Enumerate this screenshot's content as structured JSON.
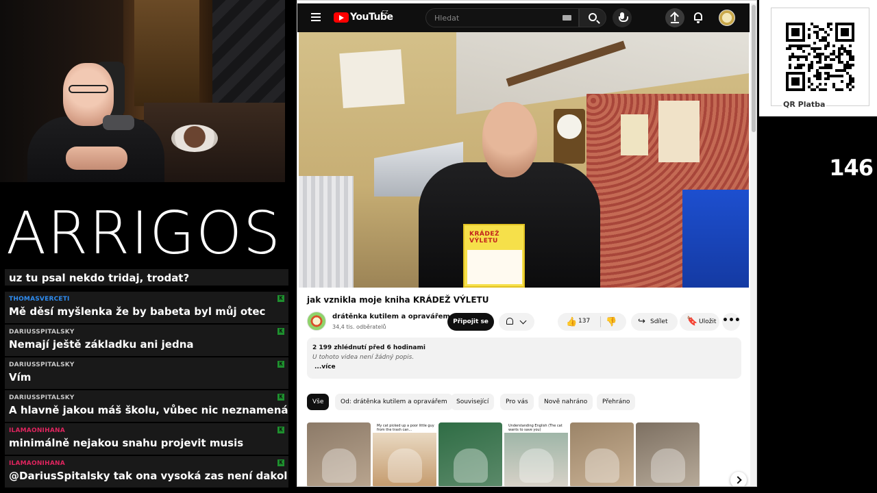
{
  "stream": {
    "logo_text": "ARRIGOS",
    "viewer_count": "146",
    "qr_label": "QR Platba"
  },
  "chat": {
    "messages": [
      {
        "user": "",
        "text": "uz tu psal nekdo tridaj, trodat?",
        "user_color": "#8a8a8a",
        "badge": false
      },
      {
        "user": "THOMASVERCETI",
        "text": "Mě děsí myšlenka že by babeta byl můj otec",
        "user_color": "#2e8cf0",
        "badge": true
      },
      {
        "user": "DARIUSSPITALSKY",
        "text": "Nemají ještě základku ani jedna",
        "user_color": "#c8c8c8",
        "badge": true
      },
      {
        "user": "DARIUSSPITALSKY",
        "text": "Vím",
        "user_color": "#c8c8c8",
        "badge": true
      },
      {
        "user": "DARIUSSPITALSKY",
        "text": "A hlavně jakou máš školu, vůbec nic neznamená",
        "user_color": "#c8c8c8",
        "badge": true
      },
      {
        "user": "ILAMAONIHANA",
        "text": "minimálně nejakou snahu projevit musis",
        "user_color": "#e0245e",
        "badge": true
      },
      {
        "user": "ILAMAONIHANA",
        "text": "@DariusSpitalsky tak ona vysoká zas není dakol",
        "user_color": "#e0245e",
        "badge": true
      }
    ],
    "badge_glyph": "K"
  },
  "youtube": {
    "brand": "YouTube",
    "region": "CZ",
    "search_placeholder": "Hledat",
    "video": {
      "book_title": "KRÁDEŽ VÝLETU",
      "title": "jak vznikla moje kniha KRÁDEŽ VÝLETU"
    },
    "channel": {
      "name": "drátěnka kutilem a opravářem",
      "subscribers": "34,4 tis. odběratelů",
      "subscribe_label": "Připojit se"
    },
    "actions": {
      "likes": "137",
      "share_label": "Sdílet",
      "save_label": "Uložit",
      "more_glyph": "•••"
    },
    "description": {
      "stats": "2 199 zhlédnutí  před 6 hodinami",
      "text": "U tohoto videa není žádný popis.",
      "more_label": "...více"
    },
    "chips": [
      "Vše",
      "Od: drátěnka kutilem a opravářem",
      "Související",
      "Pro vás",
      "Nově nahráno",
      "Přehráno"
    ],
    "thumbnails": [
      {
        "caption": "",
        "colors": [
          "#8c7a68",
          "#b9a58f"
        ]
      },
      {
        "caption": "My cat picked up a poor little guy from the trash can...",
        "colors": [
          "#e9d9c2",
          "#c49a6c"
        ]
      },
      {
        "caption": "",
        "colors": [
          "#2f6d45",
          "#5c8a6a"
        ]
      },
      {
        "caption": "Understanding English (The cat wants to save you)",
        "colors": [
          "#9fb6a8",
          "#d8d2c8"
        ]
      },
      {
        "caption": "",
        "colors": [
          "#9b8468",
          "#c9b194"
        ]
      },
      {
        "caption": "",
        "colors": [
          "#7d7062",
          "#b8ab9a"
        ]
      }
    ]
  }
}
